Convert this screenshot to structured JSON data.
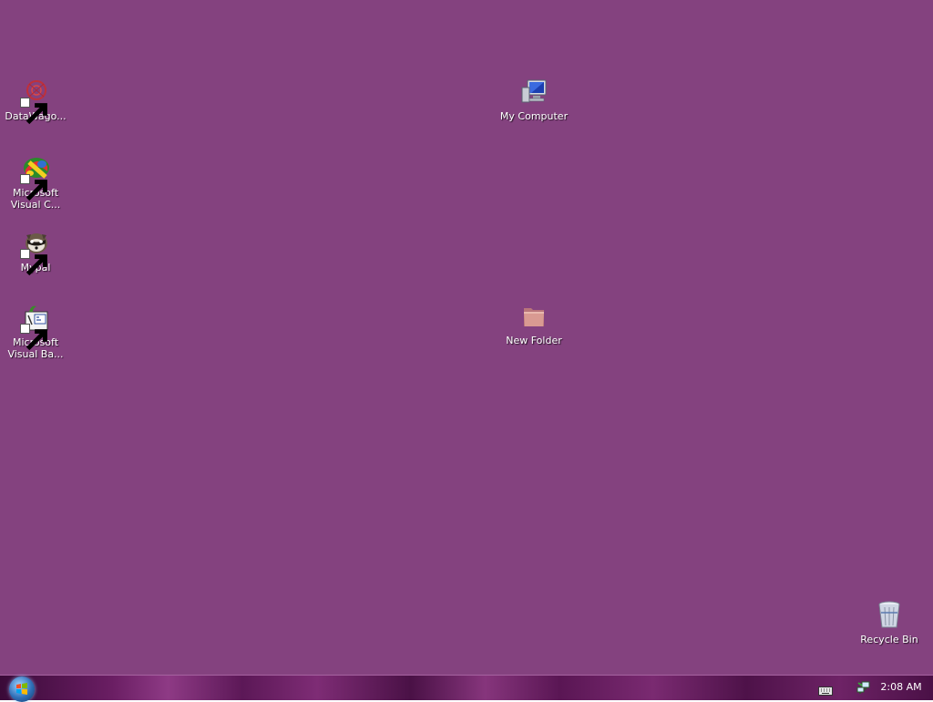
{
  "desktop": {
    "background_color": "#84427f",
    "icons": [
      {
        "label": "DataWago...",
        "icon": "datawagon-icon",
        "shortcut": true
      },
      {
        "label": "Microsoft\nVisual C...",
        "icon": "visual-c-icon",
        "shortcut": true
      },
      {
        "label": "Mypal",
        "icon": "mypal-icon",
        "shortcut": true
      },
      {
        "label": "Microsoft\nVisual Ba...",
        "icon": "visual-basic-icon",
        "shortcut": true
      },
      {
        "label": "My Computer",
        "icon": "computer-icon",
        "shortcut": false
      },
      {
        "label": "New Folder",
        "icon": "folder-icon",
        "shortcut": false
      },
      {
        "label": "Recycle Bin",
        "icon": "recycle-bin-icon",
        "shortcut": false
      }
    ]
  },
  "taskbar": {
    "start_icon": "windows-orb-icon",
    "tray_icons": [
      "keyboard-icon",
      "network-icon"
    ],
    "clock": "2:08 AM"
  }
}
